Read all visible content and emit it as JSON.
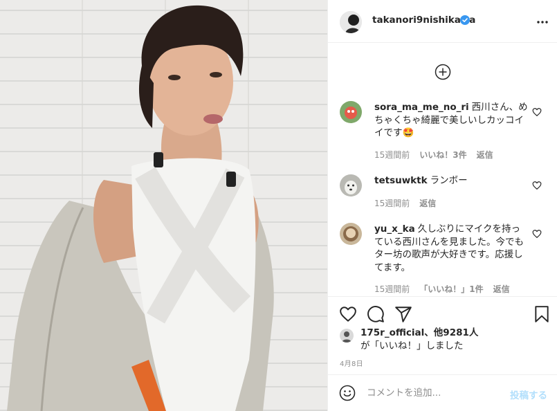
{
  "post": {
    "username": "takanori9nishikawa",
    "verified": true,
    "date": "4月8日"
  },
  "comments": [
    {
      "user": "sora_ma_me_no_ri",
      "text": "西川さん、めちゃくちゃ綺麗で美しいしカッコイイです🤩",
      "time": "15週間前",
      "likes": "いいね！3件",
      "reply": "返信"
    },
    {
      "user": "tetsuwktk",
      "text": "ランボー",
      "time": "15週間前",
      "reply": "返信"
    },
    {
      "user": "yu_x_ka",
      "text": "久しぶりにマイクを持っている西川さんを見ました。今でもター坊の歌声が大好きです。応援してます。",
      "time": "15週間前",
      "likes": "「いいね！」1件",
      "reply": "返信"
    }
  ],
  "liked_by": {
    "user": "175r_official",
    "others": "、他9281人",
    "suffix": "が「いいね！」しました"
  },
  "comment_box": {
    "placeholder": "コメントを追加...",
    "post_label": "投稿する"
  },
  "icons": {
    "more": "more-horizontal-icon",
    "load_more": "plus-circle-icon",
    "like": "heart-icon",
    "comment": "comment-icon",
    "share": "paper-plane-icon",
    "save": "bookmark-icon",
    "emoji": "emoji-icon"
  },
  "colors": {
    "verified": "#3897f0",
    "meta_text": "#8e8e8e",
    "post_button_disabled": "#b2dffc"
  }
}
